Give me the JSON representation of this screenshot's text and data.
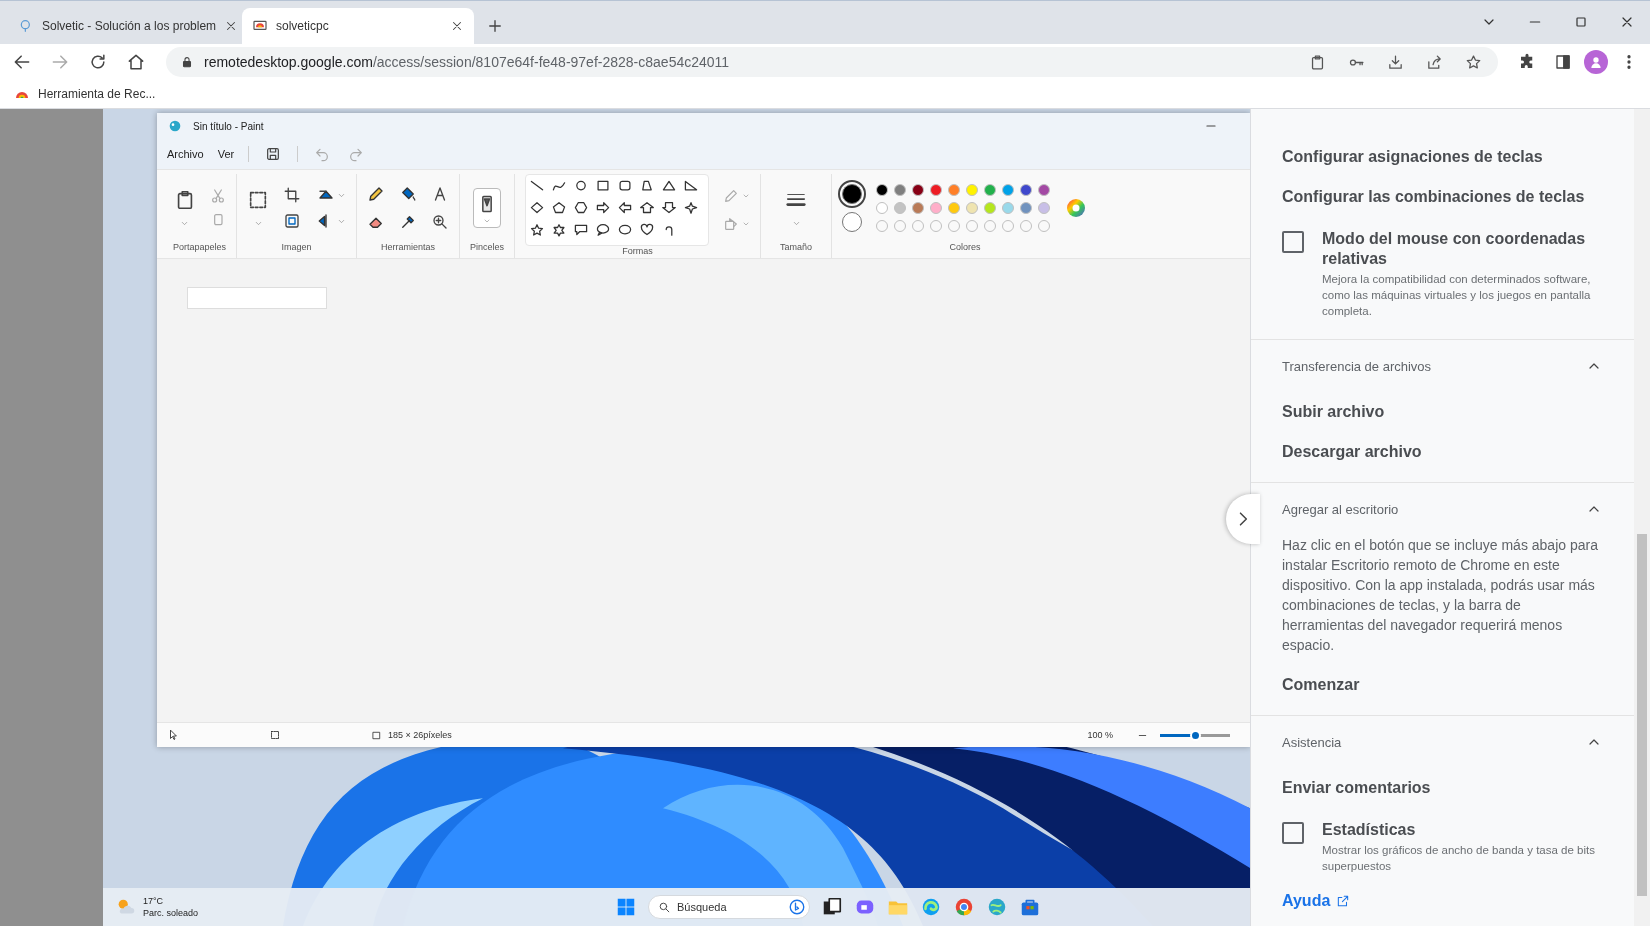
{
  "browser": {
    "tabs": [
      {
        "title": "Solvetic - Solución a los problem",
        "selected": false
      },
      {
        "title": "solveticpc",
        "selected": true
      }
    ],
    "address": {
      "host": "remotedesktop.google.com",
      "path": "/access/session/8107e64f-fe48-97ef-2828-c8ae54c24011"
    },
    "bookmarks": [
      "Herramienta de Rec..."
    ]
  },
  "paint": {
    "title": "Sin título - Paint",
    "menu": [
      "Archivo",
      "Ver"
    ],
    "groups": [
      {
        "kind": "clipboard",
        "label": "Portapapeles"
      },
      {
        "label": "Imagen"
      },
      {
        "kind": "tools",
        "label": "Herramientas"
      },
      {
        "kind": "brushes",
        "label": "Pinceles"
      },
      {
        "kind": "shapes",
        "label": "Formas"
      },
      {
        "kind": "size",
        "label": "Tamaño"
      },
      {
        "kind": "colors",
        "label": "Colores"
      }
    ],
    "current_colors": [
      {
        "color": "#000000",
        "selected": true
      },
      {
        "color": "#ffffff",
        "selected": false
      }
    ],
    "palette": [
      {
        "color": "#000000"
      },
      {
        "color": "#7f7f7f"
      },
      {
        "color": "#880015"
      },
      {
        "color": "#ed1c24"
      },
      {
        "color": "#ff7f27"
      },
      {
        "color": "#fff200"
      },
      {
        "color": "#22b14c"
      },
      {
        "color": "#00a2e8"
      },
      {
        "color": "#3f48cc"
      },
      {
        "color": "#a349a4"
      },
      {
        "color": "#ffffff"
      },
      {
        "color": "#c3c3c3"
      },
      {
        "color": "#b97a57"
      },
      {
        "color": "#ffaec9"
      },
      {
        "color": "#ffc90e"
      },
      {
        "color": "#efe4b0"
      },
      {
        "color": "#b5e61d"
      },
      {
        "color": "#99d9ea"
      },
      {
        "color": "#7092be"
      },
      {
        "color": "#c8bfe7"
      }
    ],
    "status": {
      "canvas_size": "185 × 26píxeles",
      "zoom": "100 %",
      "zoom_slider": {
        "level": 0.5
      }
    }
  },
  "taskbar": {
    "weather": {
      "temperature": "17°C",
      "condition": "Parc. soleado"
    },
    "search": {
      "placeholder": "Búsqueda"
    }
  },
  "side_panel": {
    "sections": [
      {
        "items": [
          {
            "kind": "action",
            "label": "Configurar asignaciones de teclas"
          },
          {
            "kind": "action",
            "label": "Configurar las combinaciones de teclas"
          },
          {
            "kind": "checkbox",
            "label": "Modo del mouse con coordenadas relativas",
            "description": "Mejora la compatibilidad con determinados software, como las máquinas virtuales y los juegos en pantalla completa.",
            "checked": false
          }
        ]
      },
      {
        "title": "Transferencia de archivos",
        "expanded": true,
        "items": [
          {
            "kind": "action",
            "label": "Subir archivo"
          },
          {
            "kind": "action",
            "label": "Descargar archivo"
          }
        ]
      },
      {
        "title": "Agregar al escritorio",
        "expanded": true,
        "items": [
          {
            "kind": "text",
            "text": "Haz clic en el botón que se incluye más abajo para instalar Escritorio remoto de Chrome en este dispositivo. Con la app instalada, podrás usar más combinaciones de teclas, y la barra de herramientas del navegador requerirá menos espacio."
          },
          {
            "kind": "action",
            "label": "Comenzar"
          }
        ]
      },
      {
        "title": "Asistencia",
        "expanded": true,
        "items": [
          {
            "kind": "action",
            "label": "Enviar comentarios"
          },
          {
            "kind": "checkbox",
            "label": "Estadísticas",
            "description": "Mostrar los gráficos de ancho de banda y tasa de bits superpuestos",
            "checked": false
          },
          {
            "kind": "link",
            "label": "Ayuda"
          }
        ]
      }
    ]
  }
}
